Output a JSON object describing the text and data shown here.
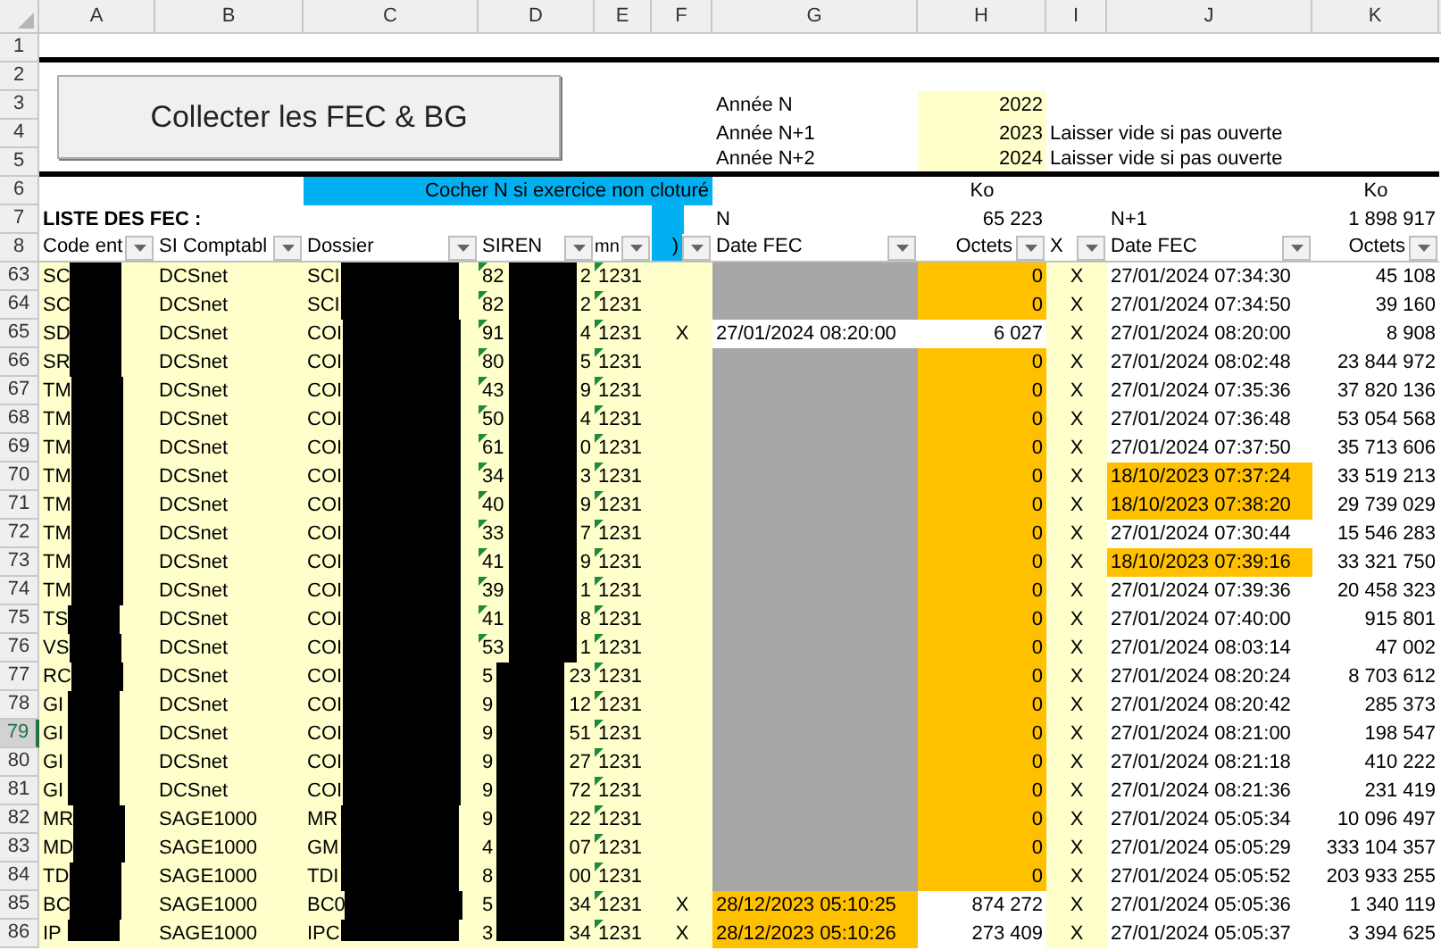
{
  "column_letters": [
    "A",
    "B",
    "C",
    "D",
    "E",
    "F",
    "G",
    "H",
    "I",
    "J",
    "K"
  ],
  "top_rows": [
    "1",
    "2",
    "3",
    "4",
    "5",
    "6",
    "7",
    "8"
  ],
  "button": {
    "label": "Collecter les FEC & BG"
  },
  "years": [
    {
      "label": "Année N",
      "value": "2022"
    },
    {
      "label": "Année N+1",
      "value": "2023",
      "note": "Laisser vide si pas ouverte"
    },
    {
      "label": "Année N+2",
      "value": "2024",
      "note": "Laisser vide si pas ouverte"
    }
  ],
  "banner": "Cocher N si exercice non cloturé",
  "unit_n": "Ko",
  "unit_n1": "Ko",
  "list_title": "LISTE DES FEC :",
  "n_label": "N",
  "n_total": "65 223",
  "n1_label": "N+1",
  "n1_total": "1 898 917",
  "columns": [
    "Code ent",
    "SI Comptabl",
    "Dossier",
    "SIREN",
    "mn",
    ")",
    "Date FEC",
    "Octets",
    "X",
    "Date FEC",
    "Octets"
  ],
  "rows": [
    {
      "num": "63",
      "code": "SC",
      "system": "DCSnet",
      "dossier": "SCI",
      "siren_start": "82",
      "siren_end": "2",
      "siren_flag": true,
      "close": "1231",
      "n_octets": "0",
      "i": "X",
      "n1_date": "27/01/2024 07:34:30",
      "n1_highlight": false,
      "n1_octets": "45 108",
      "selected": false
    },
    {
      "num": "64",
      "code": "SC",
      "system": "DCSnet",
      "dossier": "SCI",
      "siren_start": "82",
      "siren_end": "2",
      "siren_flag": true,
      "close": "1231",
      "n_octets": "0",
      "i": "X",
      "n1_date": "27/01/2024 07:34:50",
      "n1_highlight": false,
      "n1_octets": "39 160",
      "selected": false
    },
    {
      "num": "65",
      "code": "SD",
      "system": "DCSnet",
      "dossier": "COI",
      "siren_start": "91",
      "siren_end": "4",
      "siren_flag": true,
      "close": "1231",
      "f": "X",
      "n_date": "27/01/2024 08:20:00",
      "n_highlight": false,
      "n_octets": "6 027",
      "i": "X",
      "n1_date": "27/01/2024 08:20:00",
      "n1_highlight": false,
      "n1_octets": "8 908",
      "selected": false
    },
    {
      "num": "66",
      "code": "SR",
      "system": "DCSnet",
      "dossier": "COI",
      "siren_start": "80",
      "siren_end": "5",
      "siren_flag": true,
      "close": "1231",
      "n_octets": "0",
      "i": "X",
      "n1_date": "27/01/2024 08:02:48",
      "n1_highlight": false,
      "n1_octets": "23 844 972",
      "selected": false
    },
    {
      "num": "67",
      "code": "TM",
      "system": "DCSnet",
      "dossier": "COI",
      "siren_start": "43",
      "siren_end": "9",
      "siren_flag": true,
      "close": "1231",
      "n_octets": "0",
      "i": "X",
      "n1_date": "27/01/2024 07:35:36",
      "n1_highlight": false,
      "n1_octets": "37 820 136",
      "selected": false
    },
    {
      "num": "68",
      "code": "TM",
      "system": "DCSnet",
      "dossier": "COI",
      "siren_start": "50",
      "siren_end": "4",
      "siren_flag": true,
      "close": "1231",
      "n_octets": "0",
      "i": "X",
      "n1_date": "27/01/2024 07:36:48",
      "n1_highlight": false,
      "n1_octets": "53 054 568",
      "selected": false
    },
    {
      "num": "69",
      "code": "TM",
      "system": "DCSnet",
      "dossier": "COI",
      "siren_start": "61",
      "siren_end": "0",
      "siren_flag": true,
      "close": "1231",
      "n_octets": "0",
      "i": "X",
      "n1_date": "27/01/2024 07:37:50",
      "n1_highlight": false,
      "n1_octets": "35 713 606",
      "selected": false
    },
    {
      "num": "70",
      "code": "TM",
      "system": "DCSnet",
      "dossier": "COI",
      "siren_start": "34",
      "siren_end": "3",
      "siren_flag": true,
      "close": "1231",
      "n_octets": "0",
      "i": "X",
      "n1_date": "18/10/2023 07:37:24",
      "n1_highlight": true,
      "n1_octets": "33 519 213",
      "selected": false
    },
    {
      "num": "71",
      "code": "TM",
      "system": "DCSnet",
      "dossier": "COI",
      "siren_start": "40",
      "siren_end": "9",
      "siren_flag": true,
      "close": "1231",
      "n_octets": "0",
      "i": "X",
      "n1_date": "18/10/2023 07:38:20",
      "n1_highlight": true,
      "n1_octets": "29 739 029",
      "selected": false
    },
    {
      "num": "72",
      "code": "TM",
      "system": "DCSnet",
      "dossier": "COI",
      "siren_start": "33",
      "siren_end": "7",
      "siren_flag": true,
      "close": "1231",
      "n_octets": "0",
      "i": "X",
      "n1_date": "27/01/2024 07:30:44",
      "n1_highlight": false,
      "n1_octets": "15 546 283",
      "selected": false
    },
    {
      "num": "73",
      "code": "TM",
      "system": "DCSnet",
      "dossier": "COI",
      "siren_start": "41",
      "siren_end": "9",
      "siren_flag": true,
      "close": "1231",
      "n_octets": "0",
      "i": "X",
      "n1_date": "18/10/2023 07:39:16",
      "n1_highlight": true,
      "n1_octets": "33 321 750",
      "selected": false
    },
    {
      "num": "74",
      "code": "TM",
      "system": "DCSnet",
      "dossier": "COI",
      "siren_start": "39",
      "siren_end": "1",
      "siren_flag": true,
      "close": "1231",
      "n_octets": "0",
      "i": "X",
      "n1_date": "27/01/2024 07:39:36",
      "n1_highlight": false,
      "n1_octets": "20 458 323",
      "selected": false
    },
    {
      "num": "75",
      "code": "TS",
      "system": "DCSnet",
      "dossier": "COI",
      "siren_start": "41",
      "siren_end": "8",
      "siren_flag": true,
      "close": "1231",
      "n_octets": "0",
      "i": "X",
      "n1_date": "27/01/2024 07:40:00",
      "n1_highlight": false,
      "n1_octets": "915 801",
      "selected": false
    },
    {
      "num": "76",
      "code": "VS",
      "system": "DCSnet",
      "dossier": "COI",
      "siren_start": "53",
      "siren_end": "1",
      "siren_flag": true,
      "close": "1231",
      "n_octets": "0",
      "i": "X",
      "n1_date": "27/01/2024 08:03:14",
      "n1_highlight": false,
      "n1_octets": "47 002",
      "selected": false
    },
    {
      "num": "77",
      "code": "RC",
      "system": "DCSnet",
      "dossier": "COI",
      "siren_start": "5",
      "siren_end": "23",
      "siren_flag": false,
      "close": "1231",
      "n_octets": "0",
      "i": "X",
      "n1_date": "27/01/2024 08:20:24",
      "n1_highlight": false,
      "n1_octets": "8 703 612",
      "selected": false
    },
    {
      "num": "78",
      "code": "GI",
      "system": "DCSnet",
      "dossier": "COI",
      "siren_start": "9",
      "siren_end": "12",
      "siren_flag": false,
      "close": "1231",
      "n_octets": "0",
      "i": "X",
      "n1_date": "27/01/2024 08:20:42",
      "n1_highlight": false,
      "n1_octets": "285 373",
      "selected": false
    },
    {
      "num": "79",
      "code": "GI",
      "system": "DCSnet",
      "dossier": "COI",
      "siren_start": "9",
      "siren_end": "51",
      "siren_flag": false,
      "close": "1231",
      "n_octets": "0",
      "i": "X",
      "n1_date": "27/01/2024 08:21:00",
      "n1_highlight": false,
      "n1_octets": "198 547",
      "selected": true
    },
    {
      "num": "80",
      "code": "GI",
      "system": "DCSnet",
      "dossier": "COI",
      "siren_start": "9",
      "siren_end": "27",
      "siren_flag": false,
      "close": "1231",
      "n_octets": "0",
      "i": "X",
      "n1_date": "27/01/2024 08:21:18",
      "n1_highlight": false,
      "n1_octets": "410 222",
      "selected": false
    },
    {
      "num": "81",
      "code": "GI",
      "system": "DCSnet",
      "dossier": "COI",
      "siren_start": "9",
      "siren_end": "72",
      "siren_flag": false,
      "close": "1231",
      "n_octets": "0",
      "i": "X",
      "n1_date": "27/01/2024 08:21:36",
      "n1_highlight": false,
      "n1_octets": "231 419",
      "selected": false
    },
    {
      "num": "82",
      "code": "MR",
      "system": "SAGE1000",
      "dossier": "MR",
      "siren_start": "9",
      "siren_end": "22",
      "siren_flag": false,
      "close": "1231",
      "n_octets": "0",
      "i": "X",
      "n1_date": "27/01/2024 05:05:34",
      "n1_highlight": false,
      "n1_octets": "10 096 497",
      "selected": false
    },
    {
      "num": "83",
      "code": "MD",
      "system": "SAGE1000",
      "dossier": "GM",
      "siren_start": "4",
      "siren_end": "07",
      "siren_flag": false,
      "close": "1231",
      "n_octets": "0",
      "i": "X",
      "n1_date": "27/01/2024 05:05:29",
      "n1_highlight": false,
      "n1_octets": "333 104 357",
      "selected": false
    },
    {
      "num": "84",
      "code": "TD",
      "system": "SAGE1000",
      "dossier": "TDI",
      "siren_start": "8",
      "siren_end": "00",
      "siren_flag": false,
      "close": "1231",
      "n_octets": "0",
      "i": "X",
      "n1_date": "27/01/2024 05:05:52",
      "n1_highlight": false,
      "n1_octets": "203 933 255",
      "selected": false
    },
    {
      "num": "85",
      "code": "BC",
      "system": "SAGE1000",
      "dossier": "BC0",
      "siren_start": "5",
      "siren_end": "34",
      "siren_flag": false,
      "close": "1231",
      "f": "X",
      "n_date": "28/12/2023 05:10:25",
      "n_highlight": true,
      "n_octets": "874 272",
      "i": "X",
      "n1_date": "27/01/2024 05:05:36",
      "n1_highlight": false,
      "n1_octets": "1 340 119",
      "selected": false
    },
    {
      "num": "86",
      "code": "IP",
      "system": "SAGE1000",
      "dossier": "IPC",
      "siren_start": "3",
      "siren_end": "34",
      "siren_flag": false,
      "close": "1231",
      "f": "X",
      "n_date": "28/12/2023 05:10:26",
      "n_highlight": true,
      "n_octets": "273 409",
      "i": "X",
      "n1_date": "27/01/2024 05:05:37",
      "n1_highlight": false,
      "n1_octets": "3 394 625",
      "selected": false
    }
  ]
}
